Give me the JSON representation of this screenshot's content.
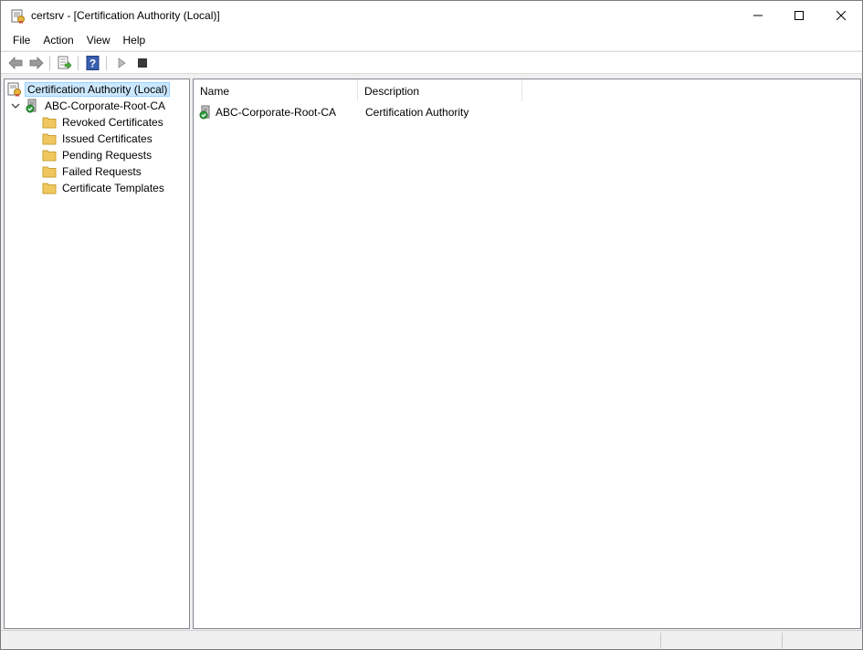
{
  "window": {
    "title": "certsrv - [Certification Authority (Local)]"
  },
  "menu": {
    "items": [
      "File",
      "Action",
      "View",
      "Help"
    ]
  },
  "toolbar": {
    "buttons": [
      "back-arrow-icon",
      "forward-arrow-icon",
      "export-list-icon",
      "help-icon",
      "start-service-icon",
      "stop-service-icon"
    ]
  },
  "tree": {
    "root": "Certification Authority (Local)",
    "ca": "ABC-Corporate-Root-CA",
    "folders": [
      "Revoked Certificates",
      "Issued Certificates",
      "Pending Requests",
      "Failed Requests",
      "Certificate Templates"
    ]
  },
  "list": {
    "columns": [
      "Name",
      "Description"
    ],
    "rows": [
      {
        "name": "ABC-Corporate-Root-CA",
        "description": "Certification Authority"
      }
    ]
  },
  "colors": {
    "selection": "#cce8ff",
    "folder": "#f0c75e",
    "check": "#2e9e3e"
  }
}
